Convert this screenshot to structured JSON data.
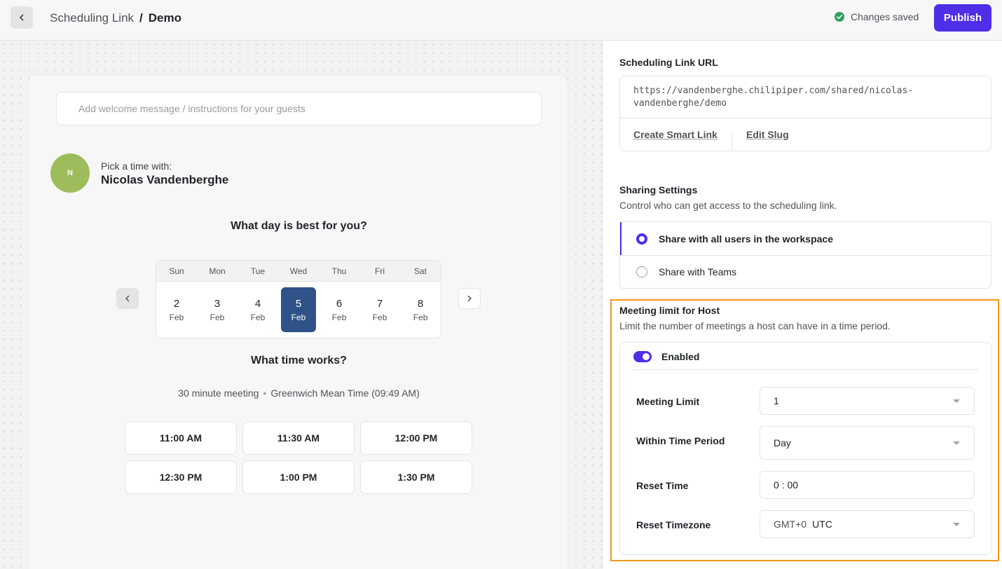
{
  "header": {
    "back_icon": "chevron-left-icon",
    "breadcrumb_parent": "Scheduling Link",
    "breadcrumb_sep": "/",
    "breadcrumb_current": "Demo",
    "status_text": "Changes saved",
    "status_color": "#2f9e5f",
    "publish_label": "Publish",
    "accent_color": "#4f2ee8"
  },
  "preview": {
    "welcome_placeholder": "Add welcome message / instructions for your guests",
    "avatar_initial": "N",
    "pick_label": "Pick a time with:",
    "host_name": "Nicolas Vandenberghe",
    "day_question": "What day is best for you?",
    "weekdays": [
      "Sun",
      "Mon",
      "Tue",
      "Wed",
      "Thu",
      "Fri",
      "Sat"
    ],
    "days": [
      {
        "num": "2",
        "month": "Feb"
      },
      {
        "num": "3",
        "month": "Feb"
      },
      {
        "num": "4",
        "month": "Feb"
      },
      {
        "num": "5",
        "month": "Feb"
      },
      {
        "num": "6",
        "month": "Feb"
      },
      {
        "num": "7",
        "month": "Feb"
      },
      {
        "num": "8",
        "month": "Feb"
      }
    ],
    "selected_day_color": "#2f5388",
    "time_question": "What time works?",
    "duration": "30 minute meeting",
    "meta_sep": "•",
    "timezone": "Greenwich Mean Time (09:49 AM)",
    "slots": [
      "11:00 AM",
      "11:30 AM",
      "12:00 PM",
      "12:30 PM",
      "1:00 PM",
      "1:30 PM"
    ]
  },
  "url_section": {
    "title": "Scheduling Link URL",
    "url": "https://vandenberghe.chilipiper.com/shared/nicolas-vandenberghe/demo",
    "create_smart_link": "Create Smart Link",
    "edit_slug": "Edit Slug"
  },
  "sharing": {
    "title": "Sharing Settings",
    "subtitle": "Control who can get access to the scheduling link.",
    "option_all": "Share with all users in the workspace",
    "option_teams": "Share with Teams"
  },
  "meeting_limit": {
    "title": "Meeting limit for Host",
    "subtitle": "Limit the number of meetings a host can have in a time period.",
    "enabled_label": "Enabled",
    "limit_label": "Meeting Limit",
    "limit_value": "1",
    "period_label": "Within Time Period",
    "period_value": "Day",
    "reset_time_label": "Reset Time",
    "reset_time_value": "0 : 00",
    "reset_tz_label": "Reset Timezone",
    "reset_tz_offset": "GMT+0",
    "reset_tz_value": "UTC",
    "highlight_color": "#f5951f"
  }
}
